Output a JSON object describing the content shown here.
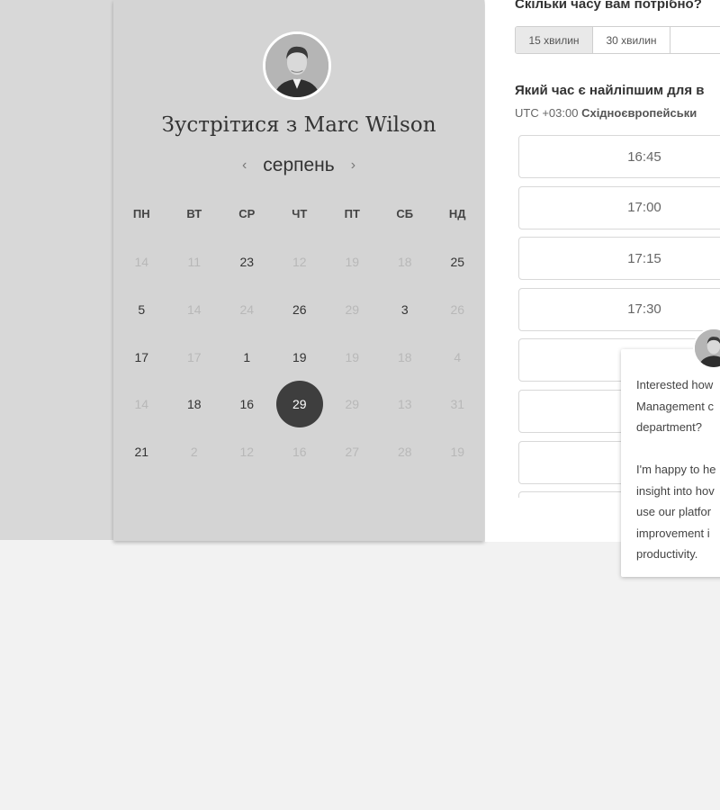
{
  "scheduler": {
    "title": "Зустрітися з Marc Wilson",
    "month": "серпень",
    "prev_icon": "chevron-left-icon",
    "next_icon": "chevron-right-icon",
    "weekdays": [
      "ПН",
      "ВТ",
      "СР",
      "ЧТ",
      "ПТ",
      "СБ",
      "НД"
    ],
    "weeks": [
      [
        {
          "d": "14",
          "on": false
        },
        {
          "d": "11",
          "on": false
        },
        {
          "d": "23",
          "on": true
        },
        {
          "d": "12",
          "on": false
        },
        {
          "d": "19",
          "on": false
        },
        {
          "d": "18",
          "on": false
        },
        {
          "d": "25",
          "on": true
        }
      ],
      [
        {
          "d": "5",
          "on": true
        },
        {
          "d": "14",
          "on": false
        },
        {
          "d": "24",
          "on": false
        },
        {
          "d": "26",
          "on": true
        },
        {
          "d": "29",
          "on": false
        },
        {
          "d": "3",
          "on": true
        },
        {
          "d": "26",
          "on": false
        }
      ],
      [
        {
          "d": "17",
          "on": true
        },
        {
          "d": "17",
          "on": false
        },
        {
          "d": "1",
          "on": true
        },
        {
          "d": "19",
          "on": true
        },
        {
          "d": "19",
          "on": false
        },
        {
          "d": "18",
          "on": false
        },
        {
          "d": "4",
          "on": false
        }
      ],
      [
        {
          "d": "14",
          "on": false
        },
        {
          "d": "18",
          "on": true
        },
        {
          "d": "16",
          "on": true
        },
        {
          "d": "29",
          "on": true,
          "selected": true
        },
        {
          "d": "29",
          "on": false
        },
        {
          "d": "13",
          "on": false
        },
        {
          "d": "31",
          "on": false
        }
      ],
      [
        {
          "d": "21",
          "on": true
        },
        {
          "d": "2",
          "on": false
        },
        {
          "d": "12",
          "on": false
        },
        {
          "d": "16",
          "on": false
        },
        {
          "d": "27",
          "on": false
        },
        {
          "d": "28",
          "on": false
        },
        {
          "d": "19",
          "on": false
        }
      ]
    ]
  },
  "booking": {
    "duration_question": "Скільки часу вам потрібно?",
    "durations": [
      "15 хвилин",
      "30 хвилин"
    ],
    "active_duration": 0,
    "time_question": "Який час є найліпшим для в",
    "timezone_offset": "UTC +03:00",
    "timezone_name": "Східноєвропейськи",
    "slots": [
      "16:45",
      "17:00",
      "17:15",
      "17:30",
      "",
      "",
      "",
      ""
    ]
  },
  "chat_popup": {
    "message": "Interested how\nManagement c\ndepartment?\n\nI'm happy to he\ninsight into hov\nuse our platfor\nimprovement i\nproductivity."
  }
}
